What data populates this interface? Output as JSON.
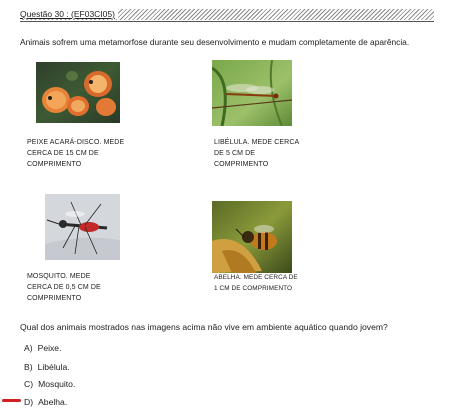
{
  "header": {
    "title": "Questão 30 :  (EF03CI05)"
  },
  "intro": "Animais sofrem uma metamorfose durante seu desenvolvimento e mudam completamente de aparência.",
  "animals": [
    {
      "image": "discus-fish-photo",
      "caption": "PEIXE ACARÁ-DISCO. MEDE CERCA DE 15 CM DE COMPRIMENTO"
    },
    {
      "image": "dragonfly-photo",
      "caption": "LIBÉLULA. MEDE CERCA DE 5 CM DE COMPRIMENTO"
    },
    {
      "image": "mosquito-photo",
      "caption": "MOSQUITO. MEDE CERCA DE 0,5 CM DE COMPRIMENTO"
    },
    {
      "image": "bee-photo",
      "caption": "ABELHA. MEDE CERCA DE 1 CM DE COMPRIMENTO"
    }
  ],
  "question": "Qual dos animais mostrados nas imagens acima não vive em ambiente aquático quando jovem?",
  "options": [
    {
      "letter": "A)",
      "text": "Peixe."
    },
    {
      "letter": "B)",
      "text": "Libélula."
    },
    {
      "letter": "C)",
      "text": "Mosquito."
    },
    {
      "letter": "D)",
      "text": "Abelha."
    }
  ],
  "colors": {
    "marker": "#d42020"
  }
}
